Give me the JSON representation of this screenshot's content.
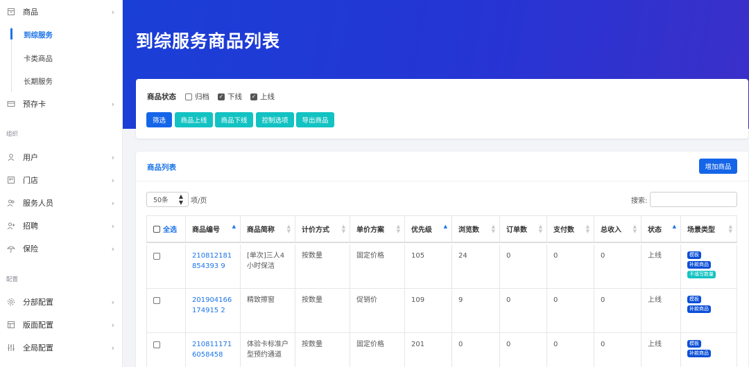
{
  "sidebar": {
    "goods": {
      "label": "商品",
      "icon": "box-icon"
    },
    "sub_items": [
      "到综服务",
      "卡类商品",
      "长期服务"
    ],
    "prepaid": {
      "label": "预存卡",
      "icon": "card-icon"
    },
    "section_org": "组织",
    "org_items": [
      {
        "label": "用户",
        "icon": "user-icon"
      },
      {
        "label": "门店",
        "icon": "store-icon"
      },
      {
        "label": "服务人员",
        "icon": "staff-icon"
      },
      {
        "label": "招聘",
        "icon": "user-add-icon"
      },
      {
        "label": "保险",
        "icon": "umbrella-icon"
      }
    ],
    "section_config": "配置",
    "config_items": [
      {
        "label": "分部配置",
        "icon": "gear-icon"
      },
      {
        "label": "版面配置",
        "icon": "layout-icon"
      },
      {
        "label": "全局配置",
        "icon": "sliders-icon"
      }
    ]
  },
  "header": {
    "title": "到综服务商品列表"
  },
  "filter": {
    "label": "商品状态",
    "options": [
      {
        "label": "归档",
        "checked": false
      },
      {
        "label": "下线",
        "checked": true
      },
      {
        "label": "上线",
        "checked": true
      }
    ],
    "buttons": [
      "筛选",
      "商品上线",
      "商品下线",
      "控制选项",
      "导出商品"
    ]
  },
  "list": {
    "title": "商品列表",
    "add_button": "增加商品",
    "page_size": "50条",
    "per_page_label": "项/页",
    "search_label": "搜索:",
    "select_all": "全选",
    "columns": [
      "商品编号",
      "商品简称",
      "计价方式",
      "单价方案",
      "优先级",
      "浏览数",
      "订单数",
      "支付数",
      "总收入",
      "状态",
      "场景类型"
    ],
    "rows": [
      {
        "id": "210812181854393 9",
        "name": "[单次]三人4小时保洁",
        "pricing": "按数量",
        "plan": "固定价格",
        "priority": "105",
        "views": "24",
        "orders": "0",
        "paid": "0",
        "income": "0",
        "status": "上线",
        "tags": [
          "模板",
          "补款商品",
          "不填写数量"
        ]
      },
      {
        "id": "201904166174915 2",
        "name": "精致擦窗",
        "pricing": "按数量",
        "plan": "促销价",
        "priority": "109",
        "views": "9",
        "orders": "0",
        "paid": "0",
        "income": "0",
        "status": "上线",
        "tags": [
          "模板",
          "补款商品"
        ]
      },
      {
        "id": "2108111716058458",
        "name": "体验卡标准户型预约通道",
        "pricing": "按数量",
        "plan": "固定价格",
        "priority": "201",
        "views": "0",
        "orders": "0",
        "paid": "0",
        "income": "0",
        "status": "上线",
        "tags": [
          "模板",
          "补款商品"
        ]
      }
    ]
  },
  "colors": {
    "primary": "#1565e8",
    "teal": "#13c2c2",
    "tag_blue": "#0b4fd8",
    "hero_start": "#1a3fd6",
    "hero_end": "#3b2fc9"
  }
}
